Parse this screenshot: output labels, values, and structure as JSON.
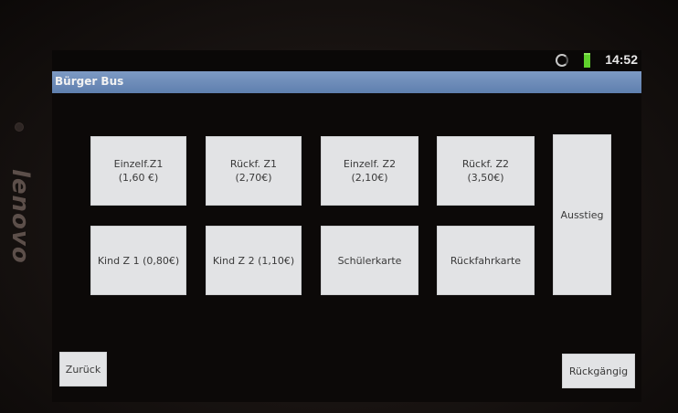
{
  "device": {
    "brand": "lenovo"
  },
  "status_bar": {
    "time": "14:52",
    "sync_icon": "sync-icon",
    "battery_icon": "battery-icon",
    "battery_color": "#5fd12c"
  },
  "app": {
    "title": "Bürger Bus",
    "title_bar_color": "#6b89b8"
  },
  "tickets": {
    "row1": [
      {
        "line1": "Einzelf.Z1",
        "line2": "(1,60 €)"
      },
      {
        "line1": "Rückf. Z1",
        "line2": "(2,70€)"
      },
      {
        "line1": "Einzelf. Z2",
        "line2": "(2,10€)"
      },
      {
        "line1": "Rückf. Z2",
        "line2": "(3,50€)"
      }
    ],
    "row2": [
      {
        "label": "Kind Z 1 (0,80€)"
      },
      {
        "label": "Kind Z 2 (1,10€)"
      },
      {
        "label": "Schülerkarte"
      },
      {
        "label": "Rückfahrkarte"
      }
    ]
  },
  "actions": {
    "ausstieg": "Ausstieg",
    "zurueck": "Zurück",
    "rueckgaengig": "Rückgängig"
  }
}
